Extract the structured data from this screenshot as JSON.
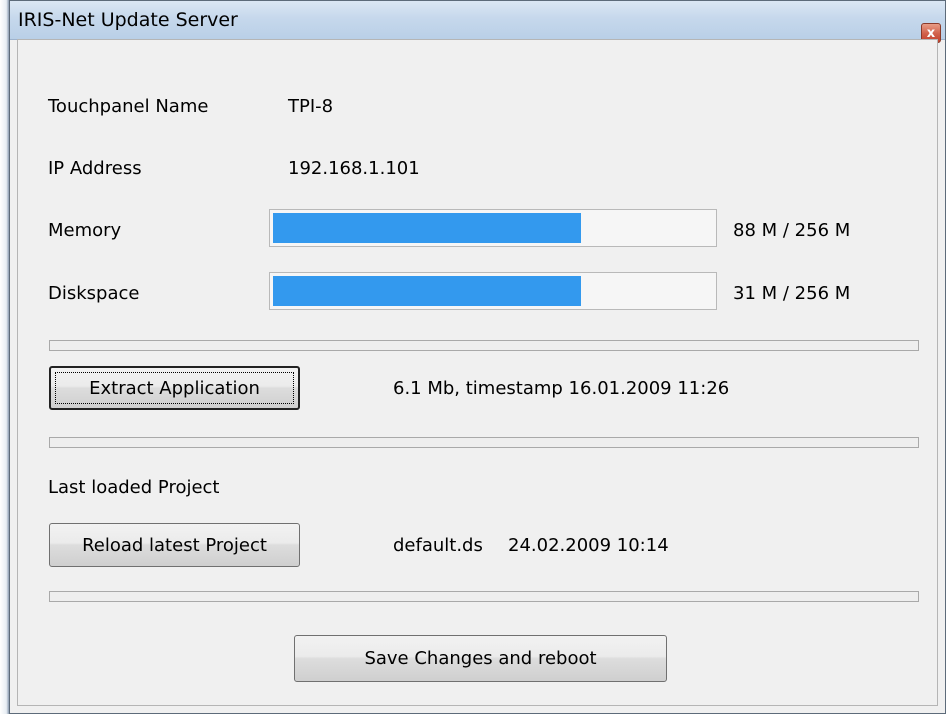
{
  "window": {
    "title": "IRIS-Net Update Server",
    "close_glyph": "x"
  },
  "touchpanel": {
    "label": "Touchpanel Name",
    "value": "TPI-8"
  },
  "ip": {
    "label": "IP Address",
    "value": "192.168.1.101"
  },
  "memory": {
    "label": "Memory",
    "text": "88 M / 256 M",
    "level": 0.7
  },
  "diskspace": {
    "label": "Diskspace",
    "text": "31 M / 256 M",
    "level": 0.7
  },
  "extract": {
    "button": "Extract Application",
    "info": "6.1 Mb, timestamp 16.01.2009 11:26"
  },
  "project": {
    "heading": "Last loaded Project",
    "button": "Reload latest Project",
    "file": "default.ds",
    "timestamp": "24.02.2009 10:14"
  },
  "save_button": "Save Changes and reboot",
  "colors": {
    "progress_fill": "#3399ee",
    "titlebar": "#c6d8ec",
    "close_button": "#c4412c"
  }
}
